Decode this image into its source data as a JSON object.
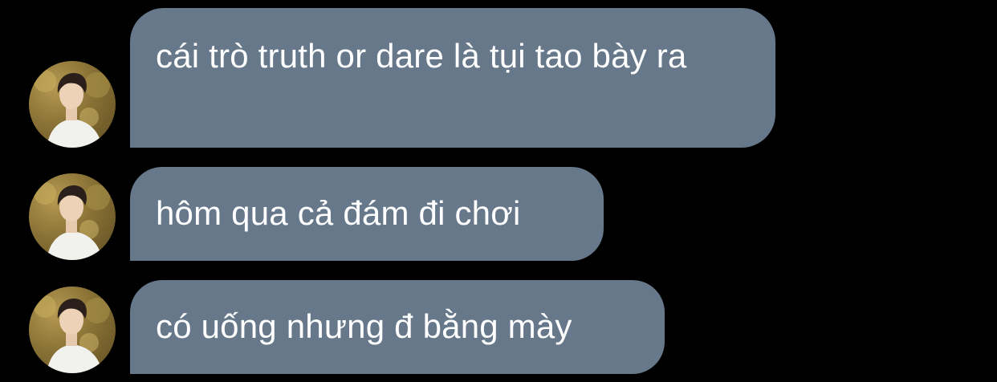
{
  "messages": [
    {
      "text": "cái trò truth or dare là tụi tao bày ra",
      "avatar": "user-avatar"
    },
    {
      "text": "hôm qua cả đám đi chơi",
      "avatar": "user-avatar"
    },
    {
      "text": "có uống nhưng đ bằng mày",
      "avatar": "user-avatar"
    }
  ],
  "colors": {
    "background": "#000000",
    "bubble": "#66788a",
    "bubble_text": "#ffffff"
  }
}
